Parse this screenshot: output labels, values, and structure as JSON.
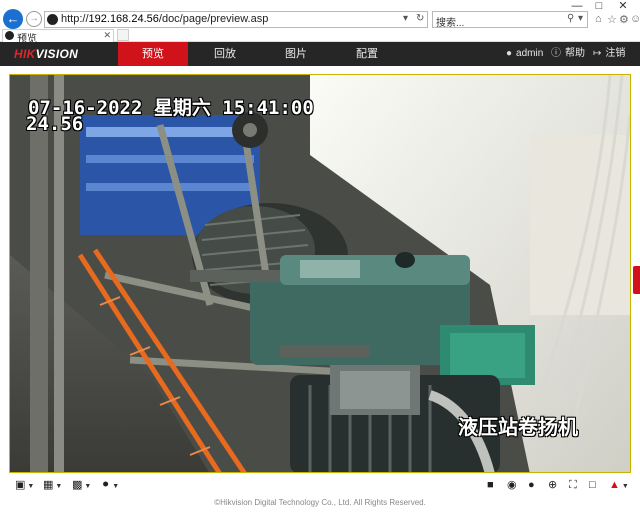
{
  "browser": {
    "url_prefix": "http://",
    "url_host": "192.168.24.56",
    "url_path": "/doc/page/preview.asp",
    "search_placeholder": "搜索...",
    "tab_title": "预览",
    "icons": [
      "back-icon",
      "forward-icon",
      "refresh-icon",
      "search-icon",
      "home-icon",
      "star-icon",
      "gear-icon",
      "smiley-icon"
    ]
  },
  "header": {
    "logo_part1": "HIK",
    "logo_part2": "VISION",
    "menu": [
      {
        "label": "预览",
        "active": true
      },
      {
        "label": "回放",
        "active": false
      },
      {
        "label": "图片",
        "active": false
      },
      {
        "label": "配置",
        "active": false
      }
    ],
    "user": "admin",
    "help": "帮助",
    "logout": "注销"
  },
  "video": {
    "osd_date": "07-16-2022 星期六 15:41:00",
    "osd_time_frag": "24.56",
    "camera_name": "液压站卷扬机"
  },
  "toolbar": {
    "left_icons": [
      "window-layout-icon",
      "stream-type-icon",
      "aspect-ratio-icon",
      "microphone-icon"
    ],
    "right_icons": [
      "stop-all-icon",
      "capture-icon",
      "record-icon",
      "zoom-in-icon",
      "fullscreen-icon",
      "region-zoom-icon",
      "volume-icon"
    ]
  },
  "footer": {
    "copyright": "©Hikvision Digital Technology Co., Ltd. All Rights Reserved."
  },
  "colors": {
    "accent_red": "#d0121b",
    "header_bg": "#262626",
    "video_border": "#c8b400"
  }
}
